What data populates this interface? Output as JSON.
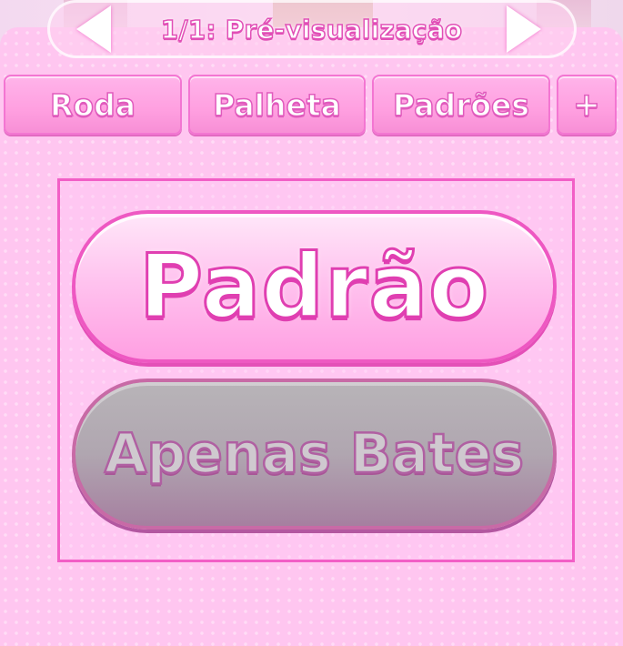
{
  "header": {
    "preview_title": "1/1: Pré-visualização"
  },
  "tabs": [
    {
      "label": "Roda"
    },
    {
      "label": "Palheta"
    },
    {
      "label": "Padrões"
    },
    {
      "label": "+"
    }
  ],
  "options": {
    "default_label": "Padrão",
    "bates_label": "Apenas Bates"
  },
  "colors": {
    "panel_pink": "#ffc6f0",
    "accent_pink": "#f25fc6",
    "disabled_gray": "#b0a6b0"
  },
  "icons": {
    "prev": "arrow-left-icon",
    "next": "arrow-right-icon"
  }
}
